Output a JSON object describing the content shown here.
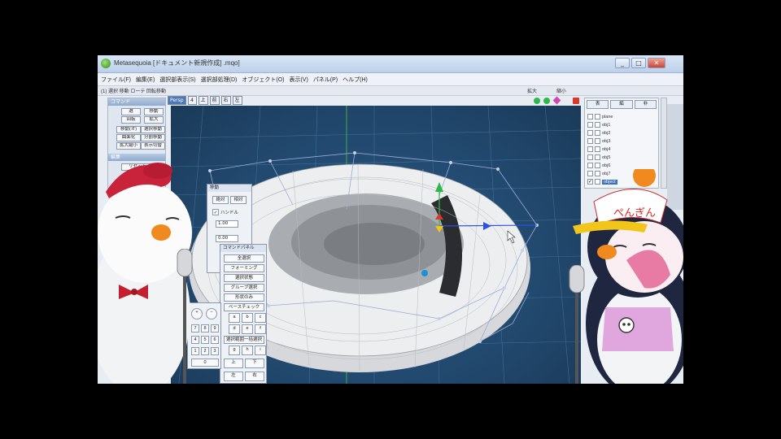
{
  "window": {
    "title": "Metasequoia [ドキュメント新規作成] .mqo]",
    "minimize": "_",
    "maximize": "□",
    "close": "✕"
  },
  "menu": [
    "ファイル(F)",
    "編集(E)",
    "選択部表示(S)",
    "選択部処理(D)",
    "オブジェクト(O)",
    "表示(V)",
    "パネル(P)",
    "ヘルプ(H)"
  ],
  "toolbar": {
    "text": "(1) 選択 移動 ローテ 回転移動",
    "right_a": "拡大",
    "right_b": "縮小"
  },
  "view_tabs": [
    "Persp",
    "4",
    "上",
    "前",
    "右",
    "左"
  ],
  "colors": {
    "viewport_bg": "#21486d",
    "gizmo_green": "#2db84a",
    "gizmo_red": "#d83a2a",
    "gizmo_blue": "#3050e0",
    "gizmo_yellow": "#f2c51a",
    "gizmo_magenta": "#d046b8"
  },
  "left_panel": {
    "header": "コマンド",
    "buttons": [
      "選",
      "移動",
      "回転",
      "拡大",
      "移動(オ)",
      "選択移動",
      "曲面化",
      "分割移動",
      "拡大縮小",
      "表示切替"
    ],
    "footer_header": "編集",
    "footer_button": "リセット"
  },
  "right_panel": {
    "headers": [
      "表",
      "編",
      "非"
    ],
    "objects": [
      "plane",
      "obj1",
      "obj2",
      "obj3",
      "obj4",
      "obj5",
      "obj6",
      "obj7",
      "object"
    ],
    "selected_object": "object"
  },
  "property_dialog": {
    "title": "移動",
    "tab_a": "絶対",
    "tab_b": "相対",
    "check_label": "ハンドル",
    "checked": true,
    "field_a": "1.00",
    "field_b": "0.00"
  },
  "command_dialog": {
    "title": "コマンドパネル",
    "buttons": [
      "全選択",
      "フォーミング",
      "選択状態",
      "グループ選択",
      "形状のみ",
      "ベースチェック",
      "選択範囲一括選択"
    ],
    "grid_buttons": [
      "a",
      "b",
      "c",
      "d",
      "e",
      "f",
      "g",
      "h",
      "i",
      "j",
      "k",
      "l"
    ],
    "bottom": [
      "上",
      "下",
      "左",
      "右"
    ]
  },
  "calc_pad": {
    "keys": [
      "+",
      "−",
      "7",
      "8",
      "9",
      "4",
      "5",
      "6",
      "1",
      "2",
      "3",
      "0"
    ]
  },
  "hat_text": "ぺんぎん"
}
